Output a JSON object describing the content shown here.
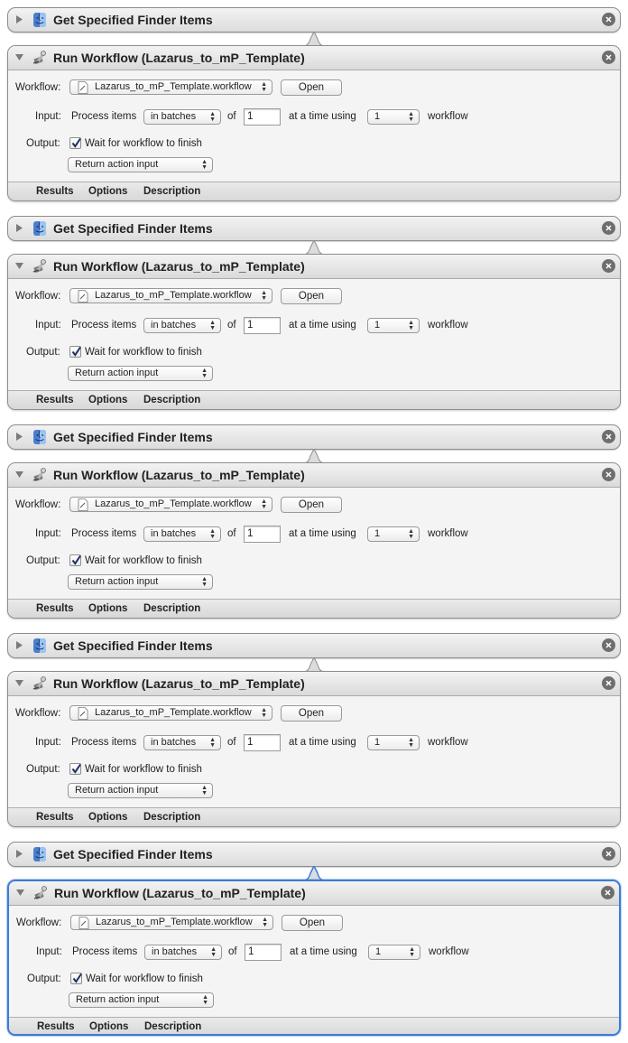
{
  "groups": [
    {
      "finder_title": "Get Specified Finder Items",
      "run_title": "Run Workflow (Lazarus_to_mP_Template)",
      "selected": false
    },
    {
      "finder_title": "Get Specified Finder Items",
      "run_title": "Run Workflow (Lazarus_to_mP_Template)",
      "selected": false
    },
    {
      "finder_title": "Get Specified Finder Items",
      "run_title": "Run Workflow (Lazarus_to_mP_Template)",
      "selected": false
    },
    {
      "finder_title": "Get Specified Finder Items",
      "run_title": "Run Workflow (Lazarus_to_mP_Template)",
      "selected": false
    },
    {
      "finder_title": "Get Specified Finder Items",
      "run_title": "Run Workflow (Lazarus_to_mP_Template)",
      "selected": true
    }
  ],
  "run_fields": {
    "workflow_label": "Workflow:",
    "workflow_file": "Lazarus_to_mP_Template.workflow",
    "open_button": "Open",
    "input_label": "Input:",
    "process_items": "Process items",
    "batch_mode": "in batches",
    "of_label": "of",
    "batch_size": "1",
    "at_a_time_using": "at a time using",
    "workflow_count": "1",
    "workflow_suffix": "workflow",
    "output_label": "Output:",
    "wait_checkbox_label": "Wait for workflow to finish",
    "wait_checked": true,
    "return_option": "Return action input"
  },
  "footer_tabs": {
    "results": "Results",
    "options": "Options",
    "description": "Description"
  },
  "colors": {
    "selection_blue": "#3d7bd8",
    "close_button": "#6e6e6e",
    "checkmark": "#1f2f64"
  },
  "icons": {
    "finder": "finder-app-icon",
    "run_workflow": "automator-robot-icon",
    "disclosure": "disclosure-triangle-icon",
    "close": "close-x-icon",
    "workflow_file": "workflow-document-icon",
    "popup": "popup-arrows-icon",
    "check": "checkmark-icon"
  }
}
